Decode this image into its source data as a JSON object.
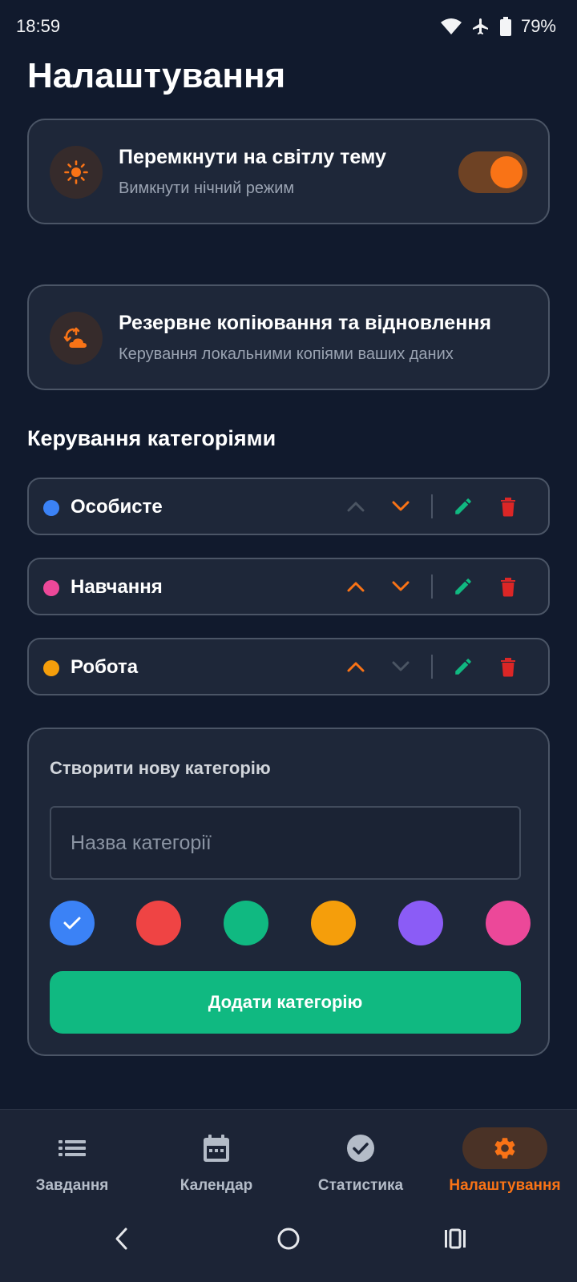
{
  "status_bar": {
    "time": "18:59",
    "battery": "79%"
  },
  "page_title": "Налаштування",
  "theme_card": {
    "title": "Перемкнути на світлу тему",
    "subtitle": "Вимкнути нічний режим",
    "icon": "sun-icon",
    "toggle_on": true
  },
  "backup_card": {
    "title": "Резервне копіювання та відновлення",
    "subtitle": "Керування локальними копіями ваших даних",
    "icon": "backup-restore-icon"
  },
  "categories_section": {
    "title": "Керування категоріями",
    "items": [
      {
        "name": "Особисте",
        "color": "#3b82f6",
        "up_enabled": false,
        "down_enabled": true
      },
      {
        "name": "Навчання",
        "color": "#ec4899",
        "up_enabled": true,
        "down_enabled": true
      },
      {
        "name": "Робота",
        "color": "#f59e0b",
        "up_enabled": true,
        "down_enabled": false
      }
    ]
  },
  "create_category": {
    "title": "Створити нову категорію",
    "input_placeholder": "Назва категорії",
    "input_value": "",
    "colors": [
      "#3b82f6",
      "#ef4444",
      "#10b981",
      "#f59e0b",
      "#8b5cf6",
      "#ec4899"
    ],
    "selected_color": "#3b82f6",
    "add_button": "Додати категорію"
  },
  "bottom_nav": {
    "items": [
      {
        "label": "Завдання",
        "icon": "list-icon",
        "active": false
      },
      {
        "label": "Календар",
        "icon": "calendar-icon",
        "active": false
      },
      {
        "label": "Статистика",
        "icon": "check-circle-icon",
        "active": false
      },
      {
        "label": "Налаштування",
        "icon": "gear-icon",
        "active": true
      }
    ]
  },
  "colors": {
    "accent": "#f97316",
    "success": "#10b981",
    "danger": "#ef4444",
    "background": "#111a2d",
    "card": "#1e2739"
  }
}
